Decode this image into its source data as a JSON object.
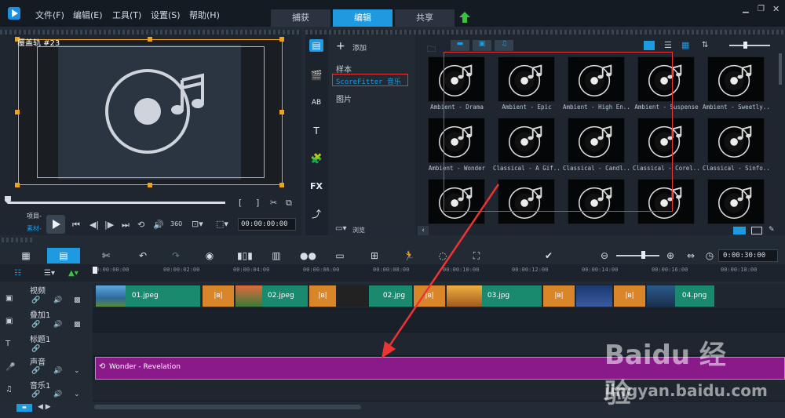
{
  "menu": {
    "file": "文件(F)",
    "edit": "编辑(E)",
    "tools": "工具(T)",
    "settings": "设置(S)",
    "help": "帮助(H)"
  },
  "tabs": {
    "capture": "捕获",
    "edit": "编辑",
    "share": "共享"
  },
  "preview": {
    "overlay_label": "覆盖轨 #23",
    "project": "项目-",
    "clip": "素材-",
    "timecode": "00:00:00:00",
    "zoom": "100%"
  },
  "library": {
    "add": "添加",
    "sample": "样本",
    "scorefitter": "ScoreFitter 音乐",
    "pictures": "图片",
    "browse": "浏览"
  },
  "thumbnails": [
    {
      "caption": "Ambient - Drama"
    },
    {
      "caption": "Ambient - Epic"
    },
    {
      "caption": "Ambient - High En..."
    },
    {
      "caption": "Ambient - Suspense"
    },
    {
      "caption": "Ambient - Sweetly..."
    },
    {
      "caption": "Ambient - Wonder"
    },
    {
      "caption": "Classical - A Gif..."
    },
    {
      "caption": "Classical - Candl..."
    },
    {
      "caption": "Classical - Corel..."
    },
    {
      "caption": "Classical - Sinfo..."
    },
    {
      "caption": ""
    },
    {
      "caption": ""
    },
    {
      "caption": ""
    },
    {
      "caption": ""
    },
    {
      "caption": ""
    }
  ],
  "timeline": {
    "timecode": "0:00:30:00",
    "ticks": [
      "00:00:00:00",
      "00:00:02:00",
      "00:00:04:00",
      "00:00:06:00",
      "00:00:08:00",
      "00:00:10:00",
      "00:00:12:00",
      "00:00:14:00",
      "00:00:16:00",
      "00:00:18:00"
    ],
    "tracks": {
      "video": "视频",
      "overlay": "叠加1",
      "title": "标题1",
      "voice": "声音",
      "music": "音乐1"
    },
    "clips": [
      "01.jpeg",
      "02.jpeg",
      "02.jpg",
      "03.jpg",
      "04.png"
    ],
    "audio_clip": "Wonder - Revelation"
  },
  "watermark": {
    "brand": "Baidu 经验",
    "url": "jingyan.baidu.com"
  }
}
